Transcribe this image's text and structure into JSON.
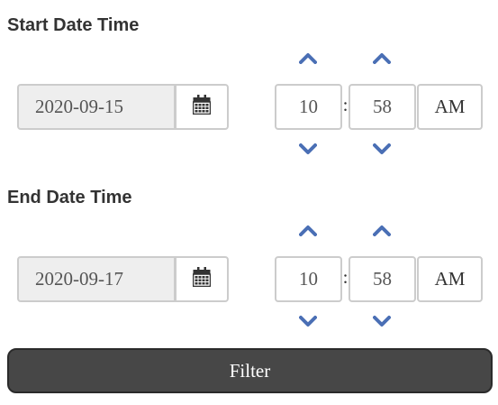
{
  "start": {
    "title": "Start Date Time",
    "date": "2020-09-15",
    "hour": "10",
    "minute": "58",
    "separator": ":",
    "period": "AM"
  },
  "end": {
    "title": "End Date Time",
    "date": "2020-09-17",
    "hour": "10",
    "minute": "58",
    "separator": ":",
    "period": "AM"
  },
  "filter": {
    "label": "Filter"
  },
  "icons": {
    "calendar": "calendar-icon",
    "increment": "chevron-up-icon",
    "decrement": "chevron-down-icon"
  },
  "colors": {
    "chevron": "#4a6fb5",
    "filter_bg": "#474747",
    "date_bg": "#eeeeee",
    "border": "#cccccc"
  }
}
